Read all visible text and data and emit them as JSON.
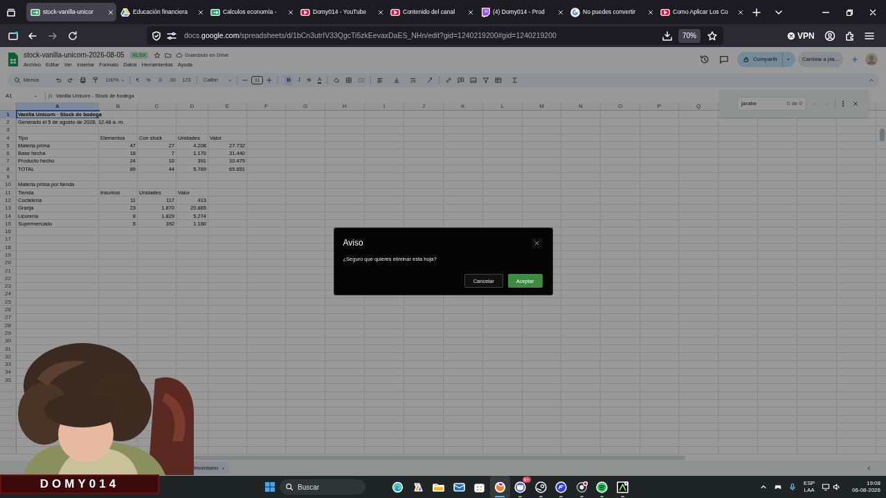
{
  "browser": {
    "tabs": [
      {
        "title": "stock-vanilla-unicor",
        "kind": "sheets",
        "selected": true
      },
      {
        "title": "Educación financiera",
        "kind": "drive",
        "selected": false
      },
      {
        "title": "Calculos economía -",
        "kind": "sheets",
        "selected": false
      },
      {
        "title": "Domy014 - YouTube",
        "kind": "video",
        "selected": false
      },
      {
        "title": "Contenido del canal",
        "kind": "video",
        "selected": false
      },
      {
        "title": "(4) Domy014 - Prod",
        "kind": "stream",
        "selected": false
      },
      {
        "title": "No puedes convertir",
        "kind": "search",
        "selected": false
      },
      {
        "title": "Como Aplicar Los Co",
        "kind": "video",
        "selected": false
      }
    ],
    "url": "docs.**google.com**/spreadsheets/d/1bCn3utrIV33QgcTi5zkEevaxDaES_NHn/edit?gid=1240219200#gid=1240219200",
    "zoom": "70%",
    "vpn": "VPN"
  },
  "sheets": {
    "title": "stock-vanilla-unicorn-2026-08-05",
    "badge": "XLSX",
    "save_status": "Guardado en Drive",
    "menu": [
      "Archivo",
      "Editar",
      "Ver",
      "Insertar",
      "Formato",
      "Datos",
      "Herramientas",
      "Ayuda"
    ],
    "share": "Compartir",
    "upgrade": "Cambiar a pla...",
    "toolbar": {
      "search": "Menús",
      "zoom": "100%",
      "currency": "€",
      "percent": "%",
      "decimals_down": ".0",
      "decimals_up": ".00",
      "format": "123",
      "font": "Calibri",
      "font_size": "11",
      "bold": "B",
      "italic": "I",
      "strike": "S",
      "text_color": "A"
    },
    "name_box": "A1",
    "fx": "fx",
    "formula": "Vanilla Unicorn - Stock de bodega",
    "columns": [
      {
        "letter": "A",
        "selected": true
      },
      {
        "letter": "B",
        "selected": false
      },
      {
        "letter": "C",
        "selected": false
      },
      {
        "letter": "D",
        "selected": false
      },
      {
        "letter": "E",
        "selected": false
      },
      {
        "letter": "F",
        "selected": false
      },
      {
        "letter": "G",
        "selected": false
      },
      {
        "letter": "H",
        "selected": false
      },
      {
        "letter": "I",
        "selected": false
      },
      {
        "letter": "J",
        "selected": false
      },
      {
        "letter": "K",
        "selected": false
      },
      {
        "letter": "L",
        "selected": false
      },
      {
        "letter": "M",
        "selected": false
      },
      {
        "letter": "N",
        "selected": false
      },
      {
        "letter": "O",
        "selected": false
      },
      {
        "letter": "P",
        "selected": false
      },
      {
        "letter": "Q",
        "selected": false
      }
    ],
    "rows": [
      {
        "number": "1",
        "kind": "title",
        "selected": true,
        "cells": [
          "Vanilla Unicorn · Stock de bodega"
        ]
      },
      {
        "number": "2",
        "kind": "text",
        "selected": false,
        "cells": [
          "Generado el 5 de agosto de 2026, 12.46 a. m."
        ]
      },
      {
        "number": "3",
        "selected": false
      },
      {
        "number": "4",
        "kind": "text",
        "selected": false,
        "cells": [
          "Tipo",
          "Elementos",
          "Con stock",
          "Unidades",
          "Valor"
        ]
      },
      {
        "number": "5",
        "kind": "data",
        "selected": false,
        "cells": [
          "Materia prima",
          "47",
          "27",
          "4.208",
          "27.732"
        ]
      },
      {
        "number": "6",
        "kind": "data",
        "selected": false,
        "cells": [
          "Base hecha",
          "18",
          "7",
          "1.170",
          "31.440"
        ]
      },
      {
        "number": "7",
        "kind": "data",
        "selected": false,
        "cells": [
          "Producto hecho",
          "24",
          "10",
          "391",
          "10.479"
        ]
      },
      {
        "number": "8",
        "kind": "data",
        "selected": false,
        "cells": [
          "TOTAL",
          "89",
          "44",
          "5.769",
          "69.651"
        ]
      },
      {
        "number": "9",
        "selected": false
      },
      {
        "number": "10",
        "kind": "text",
        "selected": false,
        "cells": [
          "Materia prima por tienda"
        ]
      },
      {
        "number": "11",
        "kind": "text",
        "selected": false,
        "cells": [
          "Tienda",
          "Insumos",
          "Unidades",
          "Valor"
        ]
      },
      {
        "number": "12",
        "kind": "data",
        "selected": false,
        "cells": [
          "Coctelería",
          "11",
          "117",
          "413"
        ]
      },
      {
        "number": "13",
        "kind": "data",
        "selected": false,
        "cells": [
          "Granja",
          "23",
          "1.870",
          "20.865"
        ]
      },
      {
        "number": "14",
        "kind": "data",
        "selected": false,
        "cells": [
          "Licorería",
          "8",
          "1.829",
          "5.274"
        ]
      },
      {
        "number": "15",
        "kind": "data",
        "selected": false,
        "cells": [
          "Supermercado",
          "5",
          "392",
          "1.180"
        ]
      },
      {
        "number": "16",
        "selected": false
      },
      {
        "number": "17",
        "selected": false
      },
      {
        "number": "18",
        "selected": false
      },
      {
        "number": "19",
        "selected": false
      },
      {
        "number": "20",
        "selected": false
      },
      {
        "number": "21",
        "selected": false
      },
      {
        "number": "22",
        "selected": false
      },
      {
        "number": "23",
        "selected": false
      },
      {
        "number": "24",
        "selected": false
      },
      {
        "number": "25",
        "selected": false
      },
      {
        "number": "26",
        "selected": false
      },
      {
        "number": "27",
        "selected": false
      },
      {
        "number": "28",
        "selected": false
      },
      {
        "number": "29",
        "selected": false
      },
      {
        "number": "30",
        "selected": false
      },
      {
        "number": "31",
        "selected": false
      },
      {
        "number": "32",
        "selected": false
      },
      {
        "number": "33",
        "selected": false
      },
      {
        "number": "34",
        "selected": false
      },
      {
        "number": "35",
        "selected": false
      }
    ],
    "find": {
      "query": "jarabe",
      "count": "0 de 0"
    },
    "sheet_tabs": [
      {
        "label": "Inventario",
        "selected": true
      }
    ]
  },
  "dialog": {
    "title": "Aviso",
    "message": "¿Seguro que quieres eliminar esta hoja?",
    "buttons": [
      {
        "label": "Cancelar",
        "kind": "secondary"
      },
      {
        "label": "Aceptar",
        "kind": "primary"
      }
    ]
  },
  "taskbar": {
    "search": "Buscar",
    "apps": [
      {
        "kind": "edge",
        "running": false,
        "active": false
      },
      {
        "kind": "copilot",
        "running": false,
        "active": false
      },
      {
        "kind": "folder",
        "running": false,
        "active": false
      },
      {
        "kind": "mail",
        "running": false,
        "active": false
      },
      {
        "kind": "store",
        "running": false,
        "active": false
      },
      {
        "kind": "firefox",
        "running": true,
        "active": true
      },
      {
        "kind": "discord",
        "running": true,
        "active": false,
        "badge": "9+"
      },
      {
        "kind": "steam",
        "running": true,
        "active": false
      },
      {
        "kind": "ea",
        "running": true,
        "active": false
      },
      {
        "kind": "obs",
        "running": true,
        "active": false
      },
      {
        "kind": "spotify",
        "running": true,
        "active": false
      },
      {
        "kind": "terminal",
        "running": true,
        "active": false
      }
    ],
    "language": "ESP",
    "layout": "LAA",
    "time": "19:08",
    "date": "06-08-2026"
  },
  "webcam": {
    "kind": "picture",
    "banner": "DOMY014"
  }
}
